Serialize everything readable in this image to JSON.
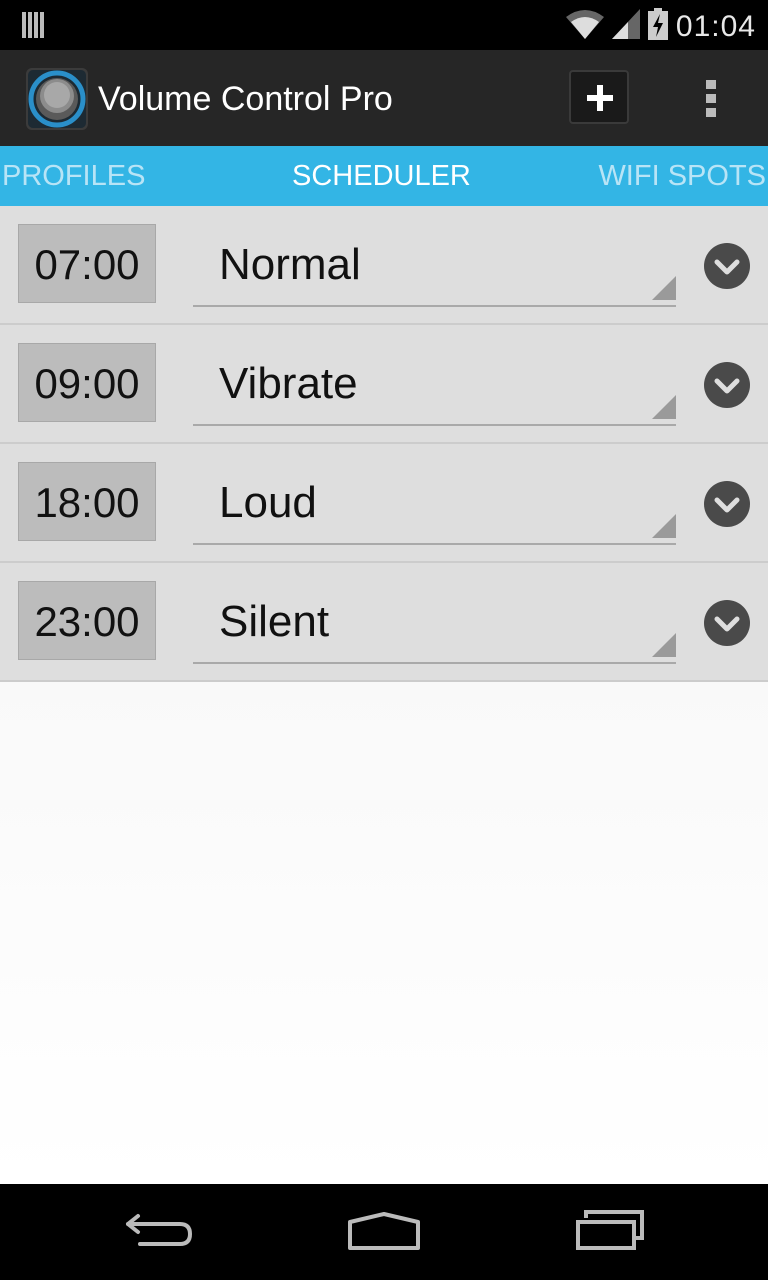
{
  "status_bar": {
    "time": "01:04",
    "icons": [
      "notification-bars-icon",
      "wifi-icon",
      "signal-icon",
      "battery-charging-icon"
    ]
  },
  "action_bar": {
    "title": "Volume Control Pro",
    "icons": [
      "app-logo-icon",
      "plus-icon",
      "overflow-menu-icon"
    ]
  },
  "tabs": [
    {
      "label": "PROFILES",
      "selected": false
    },
    {
      "label": "SCHEDULER",
      "selected": true
    },
    {
      "label": "WIFI SPOTS",
      "selected": false
    }
  ],
  "schedule": [
    {
      "time": "07:00",
      "profile": "Normal"
    },
    {
      "time": "09:00",
      "profile": "Vibrate"
    },
    {
      "time": "18:00",
      "profile": "Loud"
    },
    {
      "time": "23:00",
      "profile": "Silent"
    }
  ],
  "nav_bar": {
    "icons": [
      "back-icon",
      "home-icon",
      "recent-apps-icon"
    ]
  },
  "colors": {
    "accent": "#33b5e5",
    "action_bar": "#262626",
    "row_background": "#dedede"
  }
}
